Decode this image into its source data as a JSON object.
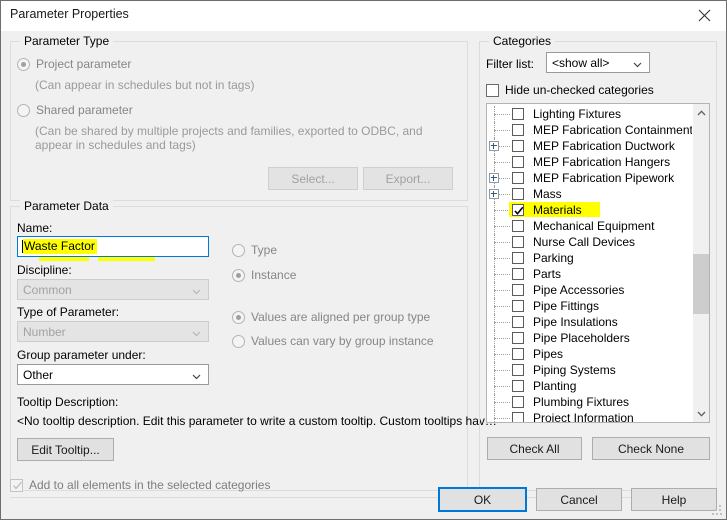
{
  "window": {
    "title": "Parameter Properties",
    "close_icon": "close-icon"
  },
  "parameter_type": {
    "legend": "Parameter Type",
    "project_radio": "Project parameter",
    "project_hint": "(Can appear in schedules but not in tags)",
    "shared_radio": "Shared parameter",
    "shared_hint_line1": "(Can be shared by multiple projects and families, exported to ODBC, and",
    "shared_hint_line2": "appear in schedules and tags)",
    "select_button": "Select...",
    "export_button": "Export..."
  },
  "parameter_data": {
    "legend": "Parameter Data",
    "name_label": "Name:",
    "name_value": "Waste Factor",
    "discipline_label": "Discipline:",
    "discipline_value": "Common",
    "type_of_parameter_label": "Type of Parameter:",
    "type_of_parameter_value": "Number",
    "group_parameter_label": "Group parameter under:",
    "group_parameter_value": "Other",
    "tooltip_label": "Tooltip Description:",
    "tooltip_text": "<No tooltip description. Edit this parameter to write a custom tooltip. Custom tooltips hav…",
    "edit_tooltip_button": "Edit Tooltip...",
    "type_radio": "Type",
    "instance_radio": "Instance",
    "aligned_radio": "Values are aligned per group type",
    "vary_radio": "Values can vary by group instance"
  },
  "categories": {
    "legend": "Categories",
    "filter_label": "Filter list:",
    "filter_value": "<show all>",
    "hide_unchecked_label": "Hide un-checked categories",
    "check_all_button": "Check All",
    "check_none_button": "Check None",
    "items": [
      {
        "label": "Lighting Fixtures",
        "checked": false,
        "expandable": false,
        "highlighted": false
      },
      {
        "label": "MEP Fabrication Containment",
        "checked": false,
        "expandable": false,
        "highlighted": false
      },
      {
        "label": "MEP Fabrication Ductwork",
        "checked": false,
        "expandable": true,
        "highlighted": false
      },
      {
        "label": "MEP Fabrication Hangers",
        "checked": false,
        "expandable": false,
        "highlighted": false
      },
      {
        "label": "MEP Fabrication Pipework",
        "checked": false,
        "expandable": true,
        "highlighted": false
      },
      {
        "label": "Mass",
        "checked": false,
        "expandable": true,
        "highlighted": false
      },
      {
        "label": "Materials",
        "checked": true,
        "expandable": false,
        "highlighted": true
      },
      {
        "label": "Mechanical Equipment",
        "checked": false,
        "expandable": false,
        "highlighted": false
      },
      {
        "label": "Nurse Call Devices",
        "checked": false,
        "expandable": false,
        "highlighted": false
      },
      {
        "label": "Parking",
        "checked": false,
        "expandable": false,
        "highlighted": false
      },
      {
        "label": "Parts",
        "checked": false,
        "expandable": false,
        "highlighted": false
      },
      {
        "label": "Pipe Accessories",
        "checked": false,
        "expandable": false,
        "highlighted": false
      },
      {
        "label": "Pipe Fittings",
        "checked": false,
        "expandable": false,
        "highlighted": false
      },
      {
        "label": "Pipe Insulations",
        "checked": false,
        "expandable": false,
        "highlighted": false
      },
      {
        "label": "Pipe Placeholders",
        "checked": false,
        "expandable": false,
        "highlighted": false
      },
      {
        "label": "Pipes",
        "checked": false,
        "expandable": false,
        "highlighted": false
      },
      {
        "label": "Piping Systems",
        "checked": false,
        "expandable": false,
        "highlighted": false
      },
      {
        "label": "Planting",
        "checked": false,
        "expandable": false,
        "highlighted": false
      },
      {
        "label": "Plumbing Fixtures",
        "checked": false,
        "expandable": false,
        "highlighted": false
      },
      {
        "label": "Project Information",
        "checked": false,
        "expandable": false,
        "highlighted": false
      }
    ]
  },
  "footer": {
    "add_all_label": "Add to all elements in the selected categories",
    "ok_button": "OK",
    "cancel_button": "Cancel",
    "help_button": "Help"
  },
  "colors": {
    "accent": "#0078d7",
    "highlight": "#ffff00",
    "dialog_bg": "#f0f0f0"
  }
}
